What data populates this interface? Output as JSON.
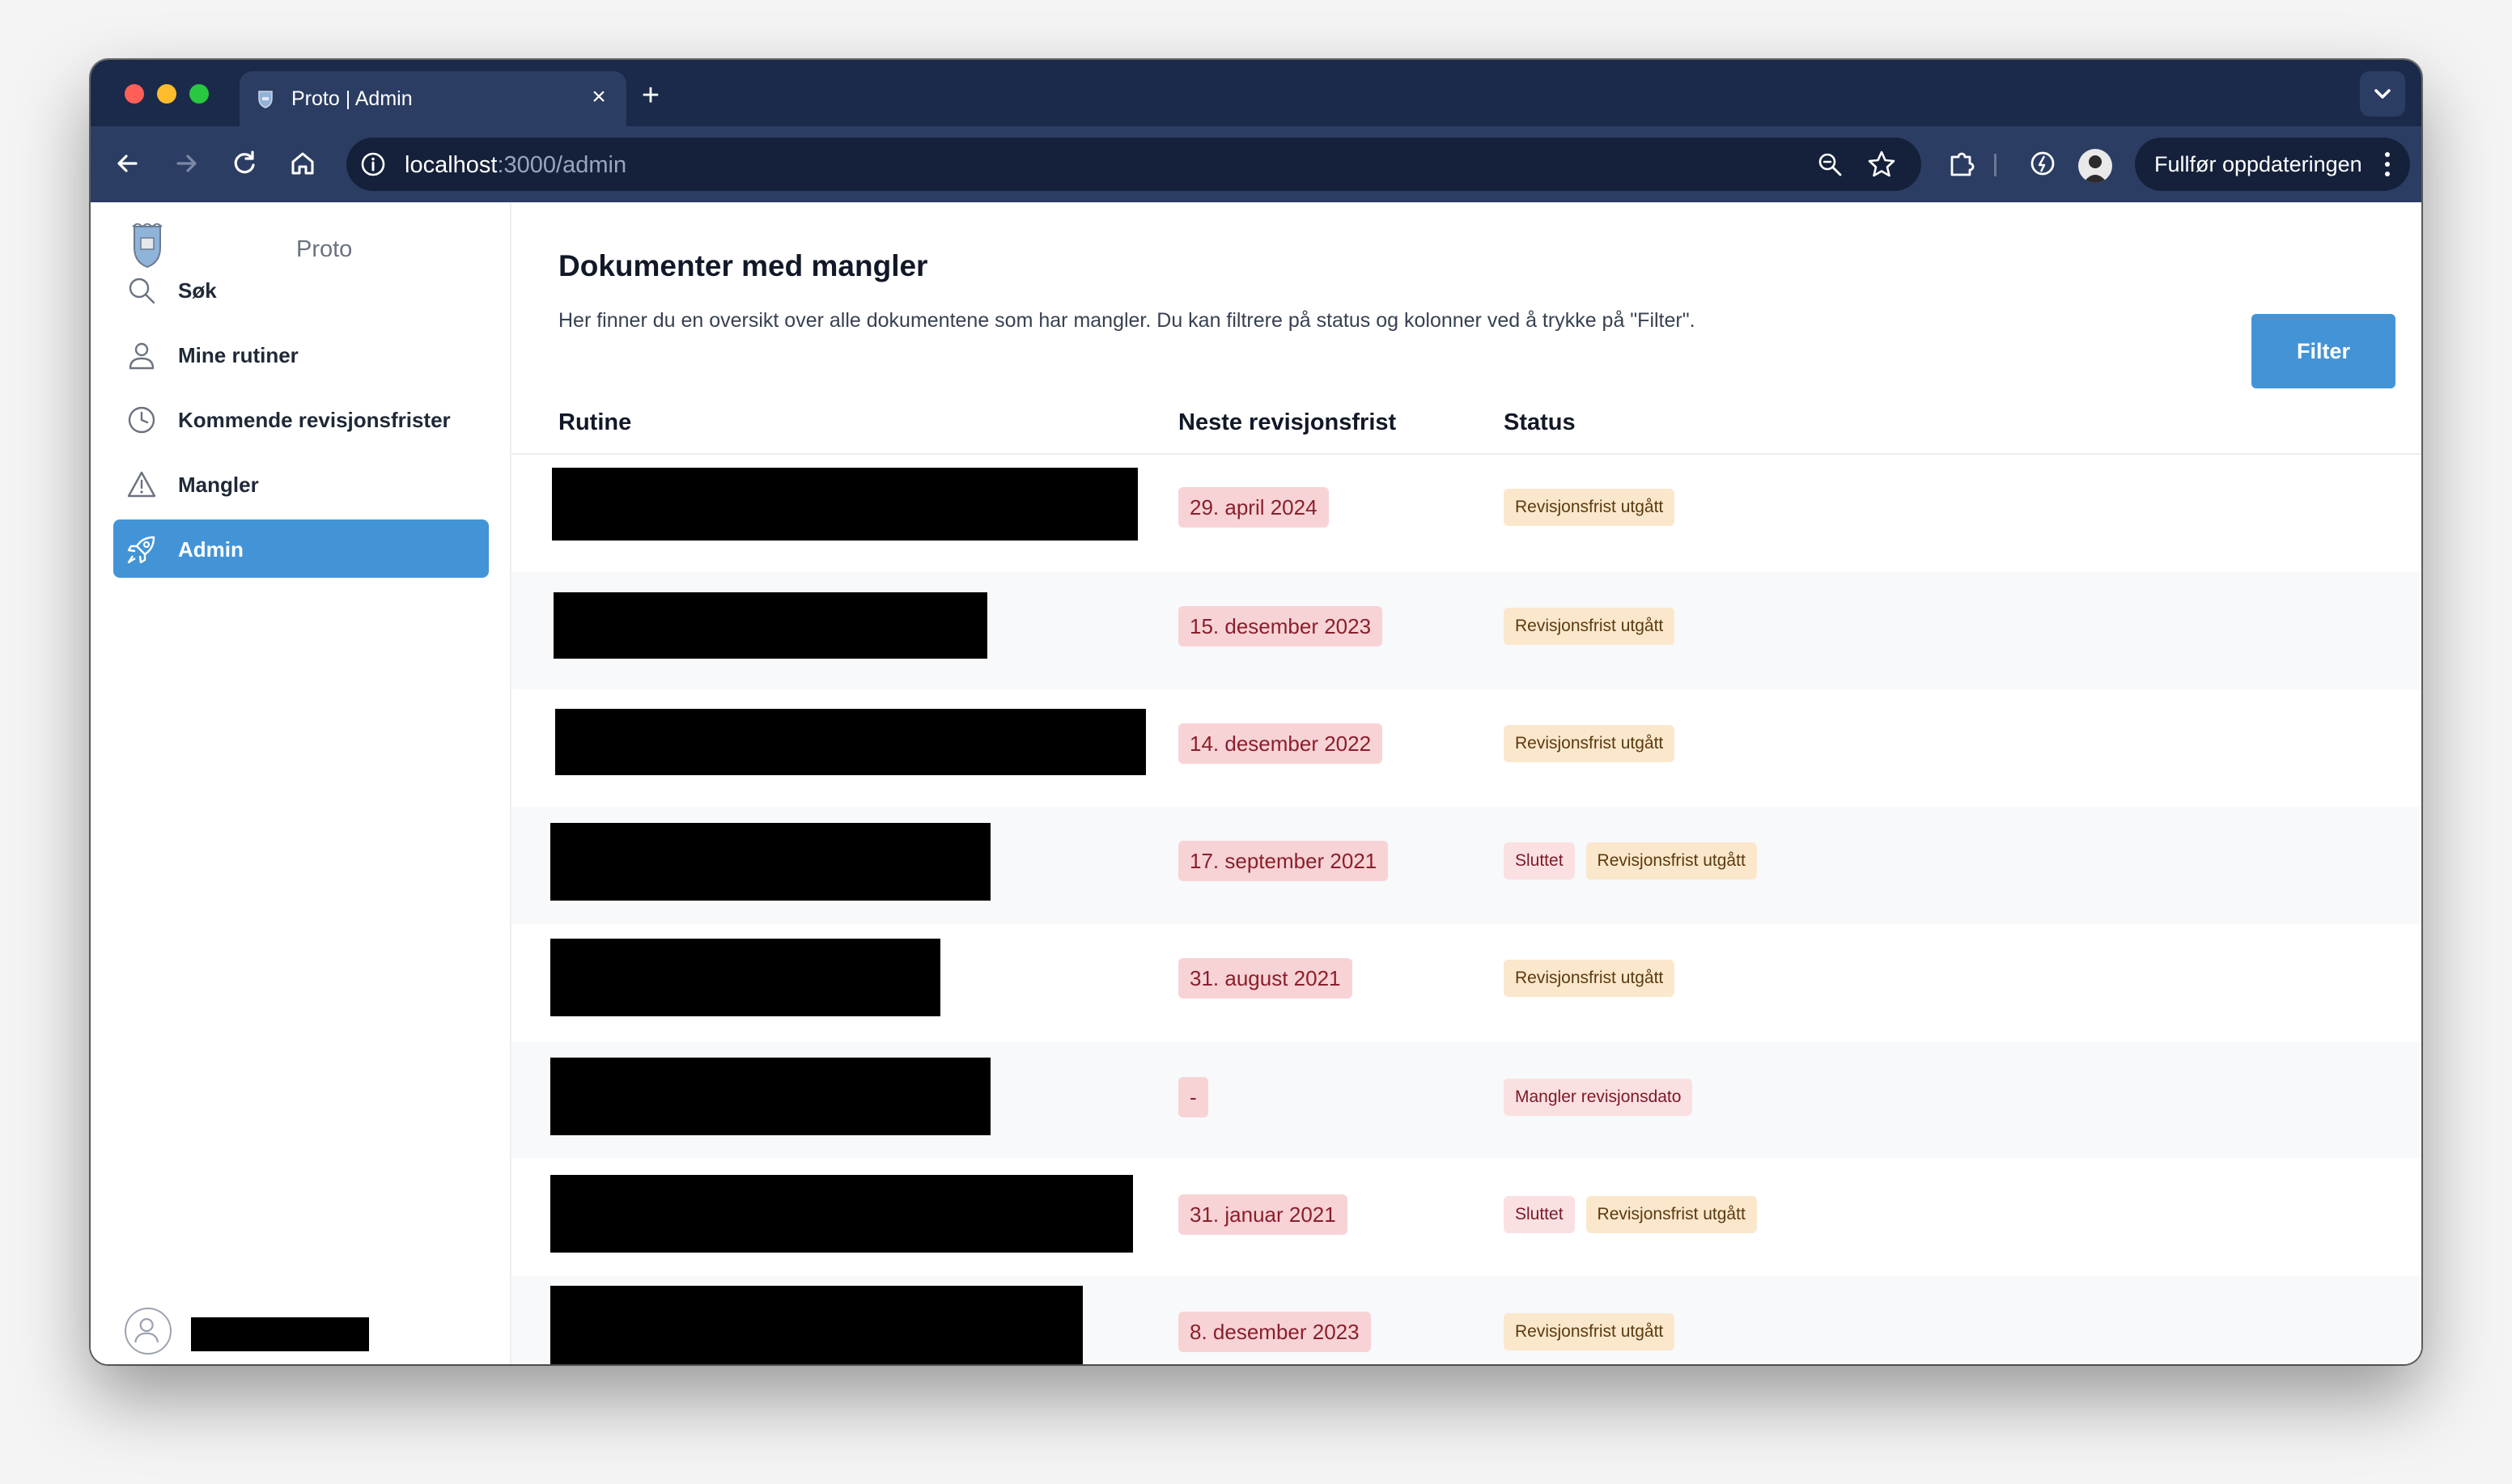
{
  "browser": {
    "tab_title": "Proto | Admin",
    "url_host": "localhost",
    "url_path": ":3000/admin",
    "update_label": "Fullfør oppdateringen"
  },
  "sidebar": {
    "brand": "Proto",
    "items": [
      {
        "label": "Søk",
        "icon": "search-icon"
      },
      {
        "label": "Mine rutiner",
        "icon": "user-icon"
      },
      {
        "label": "Kommende revisjonsfrister",
        "icon": "clock-icon"
      },
      {
        "label": "Mangler",
        "icon": "warning-icon"
      },
      {
        "label": "Admin",
        "icon": "rocket-icon",
        "active": true
      }
    ]
  },
  "main": {
    "title": "Dokumenter med mangler",
    "description": "Her finner du en oversikt over alle dokumentene som har mangler. Du kan filtrere på status og kolonner ved å trykke på \"Filter\".",
    "filter_label": "Filter",
    "columns": [
      "Rutine",
      "Neste revisjonsfrist",
      "Status"
    ],
    "rows": [
      {
        "date": "29. april 2024",
        "statuses": [
          "Revisjonsfrist utgått"
        ]
      },
      {
        "date": "15. desember 2023",
        "statuses": [
          "Revisjonsfrist utgått"
        ]
      },
      {
        "date": "14. desember 2022",
        "statuses": [
          "Revisjonsfrist utgått"
        ]
      },
      {
        "date": "17. september 2021",
        "statuses": [
          "Sluttet",
          "Revisjonsfrist utgått"
        ]
      },
      {
        "date": "31. august 2021",
        "statuses": [
          "Revisjonsfrist utgått"
        ]
      },
      {
        "date": "-",
        "statuses": [
          "Mangler revisjonsdato"
        ]
      },
      {
        "date": "31. januar 2021",
        "statuses": [
          "Sluttet",
          "Revisjonsfrist utgått"
        ]
      },
      {
        "date": "8. desember 2023",
        "statuses": [
          "Revisjonsfrist utgått"
        ]
      }
    ]
  },
  "colors": {
    "accent": "#4394d7",
    "chrome_dark": "#1b2a4a",
    "date_badge_bg": "#f8d3d6",
    "status_warn_bg": "#fbe7cc",
    "status_danger_bg": "#fbe0e2"
  }
}
